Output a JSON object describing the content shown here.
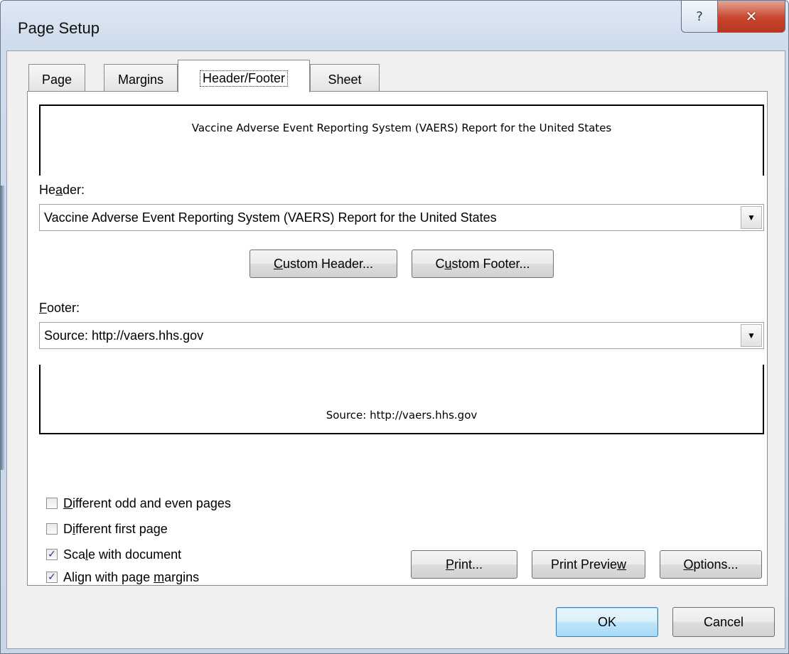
{
  "window": {
    "title": "Page Setup",
    "help_glyph": "?",
    "close_glyph": "✕"
  },
  "tabs": [
    {
      "label": "Page",
      "active": false
    },
    {
      "label": "Margins",
      "active": false
    },
    {
      "label": "Header/Footer",
      "active": true
    },
    {
      "label": "Sheet",
      "active": false
    }
  ],
  "header": {
    "preview_text": "Vaccine Adverse Event Reporting System (VAERS) Report for the United States",
    "label_pre": "He",
    "label_mnemonic": "a",
    "label_post": "der:",
    "value": "Vaccine Adverse Event Reporting System (VAERS) Report for the United States"
  },
  "custom_header": {
    "mnemonic": "C",
    "rest": "ustom Header..."
  },
  "custom_footer": {
    "pre": "C",
    "mnemonic": "u",
    "rest": "stom Footer..."
  },
  "footer": {
    "label_mnemonic": "F",
    "label_post": "ooter:",
    "value": "Source: http://vaers.hhs.gov",
    "preview_text": "Source: http://vaers.hhs.gov"
  },
  "options": [
    {
      "pre": "",
      "mnemonic": "D",
      "post": "ifferent odd and even pages",
      "checked": false
    },
    {
      "pre": "D",
      "mnemonic": "i",
      "post": "fferent first page",
      "checked": false
    },
    {
      "pre": "Sca",
      "mnemonic": "l",
      "post": "e with document",
      "checked": true
    },
    {
      "pre": "Align with page ",
      "mnemonic": "m",
      "post": "argins",
      "checked": true
    }
  ],
  "buttons": {
    "print": {
      "mnemonic": "P",
      "rest": "rint..."
    },
    "print_preview": {
      "pre": "Print Previe",
      "mnemonic": "w"
    },
    "options": {
      "mnemonic": "O",
      "rest": "ptions..."
    },
    "ok": "OK",
    "cancel": "Cancel"
  },
  "checkmark_glyph": "✓",
  "dropdown_glyph": "▼",
  "colors": {
    "frame": "#c9d7e8",
    "close_button": "#c8462e",
    "default_button_border": "#3c7fb1"
  }
}
